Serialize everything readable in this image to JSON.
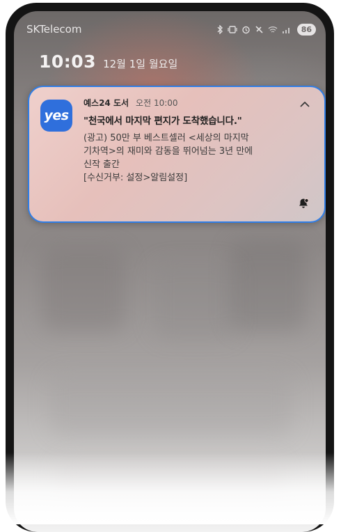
{
  "status_bar": {
    "carrier": "SKTelecom",
    "battery": "86"
  },
  "lockscreen": {
    "time": "10:03",
    "date": "12월 1일 월요일"
  },
  "notification": {
    "app_name": "예스24 도서",
    "time": "오전 10:00",
    "icon_text": "yes",
    "title": "\"천국에서 마지막 편지가 도착했습니다.\"",
    "body_lines": [
      "(광고) 50만 부 베스트셀러 <세상의 마지막",
      "기차역>의 재미와 감동을 뛰어넘는 3년 만에",
      "신작 출간",
      "[수신거부: 설정>알림설정]"
    ],
    "accent_color": "#2f7de6",
    "icon_color": "#2f6fdc"
  }
}
